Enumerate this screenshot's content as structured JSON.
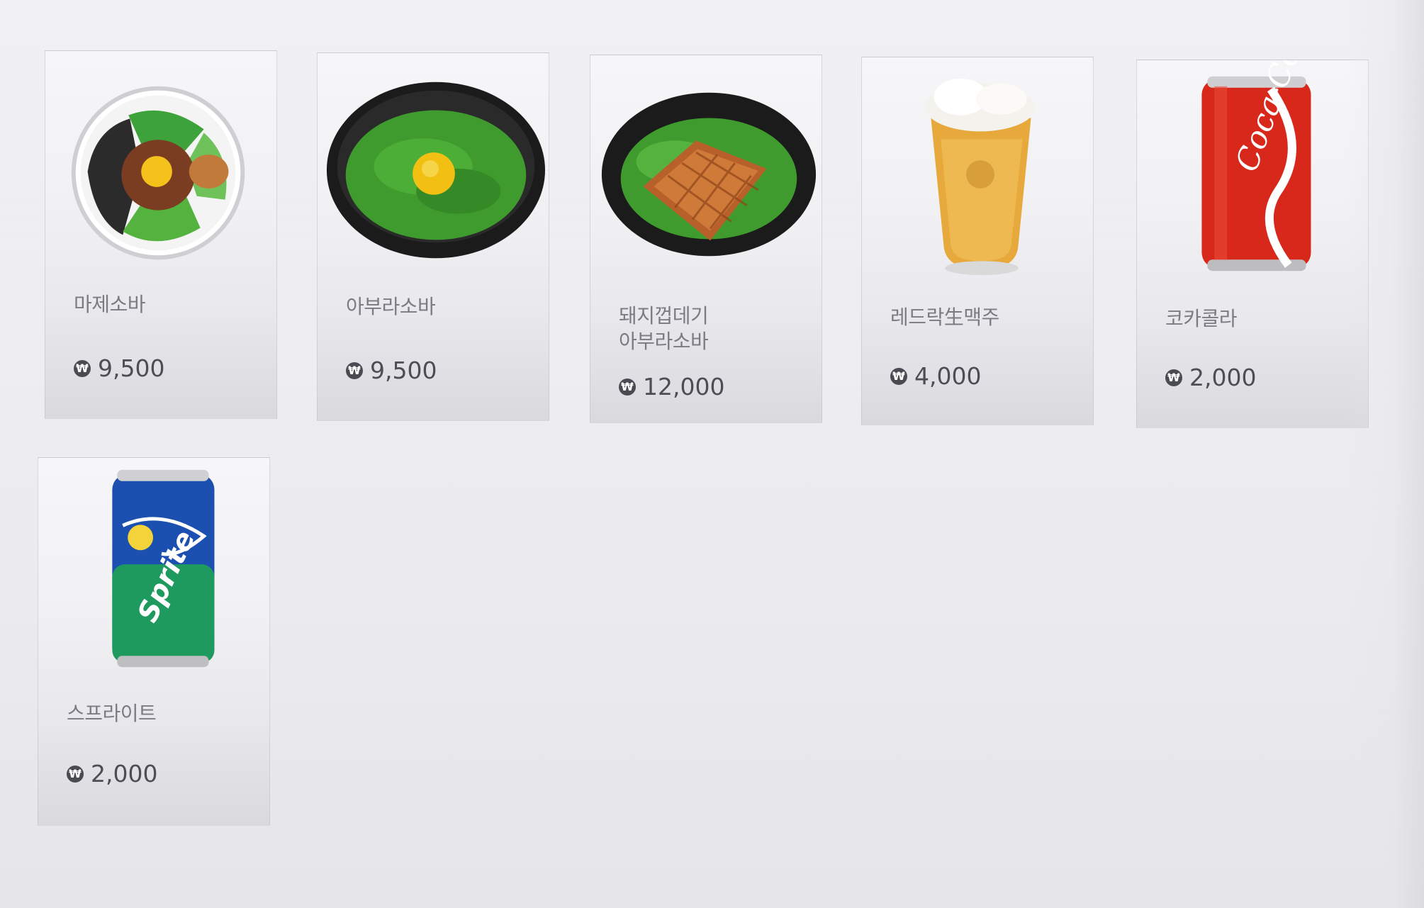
{
  "menu": {
    "items": [
      {
        "name": "마제소바",
        "currency_icon": "won-icon",
        "price": "9,500",
        "image": "mazesoba-bowl"
      },
      {
        "name": "아부라소바",
        "currency_icon": "won-icon",
        "price": "9,500",
        "image": "aburasoba-bowl"
      },
      {
        "name": "돼지껍데기 아부라소바",
        "currency_icon": "won-icon",
        "price": "12,000",
        "image": "pork-skin-aburasoba-bowl"
      },
      {
        "name": "레드락生맥주",
        "currency_icon": "won-icon",
        "price": "4,000",
        "image": "draft-beer-glass"
      },
      {
        "name": "코카콜라",
        "currency_icon": "won-icon",
        "price": "2,000",
        "image": "coca-cola-can"
      },
      {
        "name": "스프라이트",
        "currency_icon": "won-icon",
        "price": "2,000",
        "image": "sprite-can"
      }
    ]
  },
  "colors": {
    "card_text": "#7b7b82",
    "price_text": "#4d4d55",
    "cola_red": "#d8281b",
    "sprite_blue": "#1b4fb0",
    "sprite_green": "#1f9a5f",
    "beer": "#e7a93c",
    "greens": "#3f9b2d"
  }
}
